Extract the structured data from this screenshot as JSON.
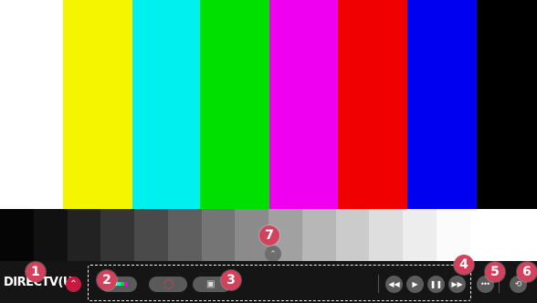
{
  "test_pattern": {
    "color_bars": [
      "#ffffff",
      "#f5f500",
      "#00f0f0",
      "#00e000",
      "#f000f0",
      "#f00000",
      "#0000f0",
      "#000000"
    ],
    "gray_ramp": [
      "#050505",
      "#111111",
      "#222222",
      "#353535",
      "#4a4a4a",
      "#5f5f5f",
      "#757575",
      "#8b8b8b",
      "#a1a1a1",
      "#b7b7b7",
      "#cbcbcb",
      "#dedede",
      "#ededed",
      "#fbfbfb",
      "#ffffff",
      "#ffffff"
    ]
  },
  "control_bar": {
    "channel_name": "DIRECTV(U",
    "up_icon": "chevron-up-icon",
    "input_pills": [
      {
        "name": "picture-input-pill",
        "icon": "color-bars-icon"
      },
      {
        "name": "record-pill",
        "icon": "record-icon"
      },
      {
        "name": "screen-pill",
        "icon": "screen-icon"
      }
    ],
    "media_buttons": [
      {
        "name": "rewind-button",
        "icon": "rewind-icon",
        "glyph": "◀◀"
      },
      {
        "name": "play-button",
        "icon": "play-icon",
        "glyph": "▶"
      },
      {
        "name": "pause-button",
        "icon": "pause-icon",
        "glyph": "❚❚"
      },
      {
        "name": "fast-forward-button",
        "icon": "fast-forward-icon",
        "glyph": "▶▶"
      }
    ],
    "more_button": {
      "icon": "more-icon",
      "glyph": "•••"
    },
    "exit_button": {
      "icon": "exit-icon",
      "glyph": "⟲"
    }
  },
  "callouts": [
    "1",
    "2",
    "3",
    "4",
    "5",
    "6",
    "7"
  ],
  "colors": {
    "accent": "#c61a3f",
    "callout": "#d2425d"
  }
}
